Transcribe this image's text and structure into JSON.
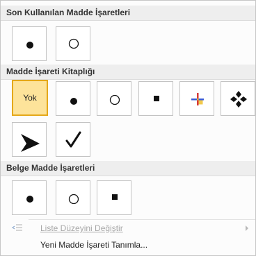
{
  "sections": {
    "recent_title": "Son Kullanılan Madde İşaretleri",
    "library_title": "Madde İşareti Kitaplığı",
    "document_title": "Belge Madde İşaretleri"
  },
  "library": {
    "none_label": "Yok"
  },
  "commands": {
    "change_list_level": "Liste Düzeyini Değiştir",
    "define_new_bullet": "Yeni Madde İşareti Tanımla..."
  },
  "colors": {
    "selected_fill": "#fde39a",
    "selected_border": "#e4a81a",
    "header_bg": "#eeeeee",
    "tile_border": "#c3c3c3"
  },
  "icons": {
    "bullets": [
      "filled-circle-icon",
      "hollow-circle-icon",
      "filled-square-icon",
      "color-plus-icon",
      "four-diamond-icon",
      "arrowhead-icon",
      "checkmark-icon"
    ],
    "commands": [
      "list-level-icon"
    ]
  }
}
